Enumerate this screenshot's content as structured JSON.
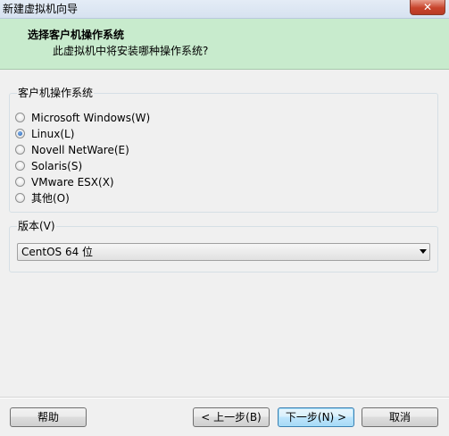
{
  "window": {
    "title": "新建虚拟机向导",
    "close_glyph": "✕"
  },
  "header": {
    "title": "选择客户机操作系统",
    "subtitle": "此虚拟机中将安装哪种操作系统?"
  },
  "guest_os": {
    "group_label": "客户机操作系统",
    "selected": "Linux(L)",
    "options": [
      {
        "label": "Microsoft Windows(W)",
        "checked": false
      },
      {
        "label": "Linux(L)",
        "checked": true
      },
      {
        "label": "Novell NetWare(E)",
        "checked": false
      },
      {
        "label": "Solaris(S)",
        "checked": false
      },
      {
        "label": "VMware ESX(X)",
        "checked": false
      },
      {
        "label": "其他(O)",
        "checked": false
      }
    ]
  },
  "version": {
    "group_label": "版本(V)",
    "selected": "CentOS 64 位"
  },
  "buttons": {
    "help": "帮助",
    "back": "< 上一步(B)",
    "next": "下一步(N) >",
    "cancel": "取消"
  },
  "colors": {
    "banner_bg": "#c8ebcd",
    "window_bg": "#f0f0f0",
    "radio_checked": "#1f5fb4"
  }
}
